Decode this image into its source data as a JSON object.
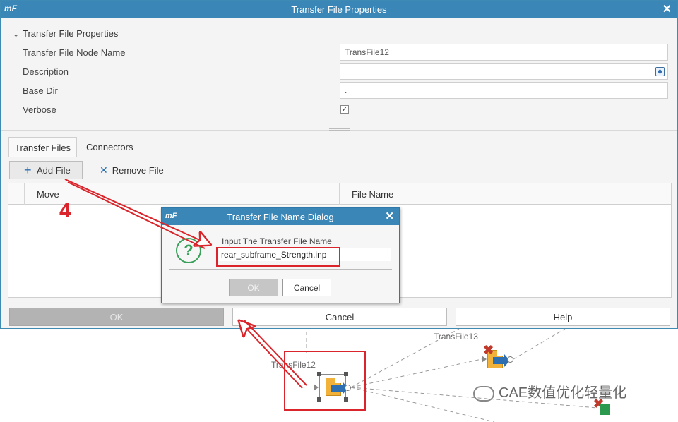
{
  "main_dialog": {
    "logo": "mF",
    "title": "Transfer File Properties",
    "close": "✕",
    "section": {
      "toggle": "⌄",
      "title": "Transfer File Properties",
      "fields": {
        "node_name_label": "Transfer File Node Name",
        "node_name_value": "TransFile12",
        "description_label": "Description",
        "description_value": "",
        "base_dir_label": "Base Dir",
        "base_dir_value": ".",
        "verbose_label": "Verbose",
        "verbose_checked": "✓"
      }
    },
    "tabs": [
      {
        "label": "Transfer Files",
        "active": true
      },
      {
        "label": "Connectors",
        "active": false
      }
    ],
    "toolbar": {
      "add_icon": "+",
      "add_label": "Add File",
      "remove_icon": "✕",
      "remove_label": "Remove File"
    },
    "table": {
      "columns": [
        "Move",
        "File Name"
      ]
    },
    "buttons": {
      "ok": "OK",
      "cancel": "Cancel",
      "help": "Help"
    }
  },
  "name_dialog": {
    "logo": "mF",
    "title": "Transfer File Name Dialog",
    "close": "✕",
    "icon": "?",
    "prompt": "Input The Transfer File Name",
    "input_value": "rear_subframe_Strength.inp",
    "ok": "OK",
    "cancel": "Cancel"
  },
  "annotation": {
    "step": "4"
  },
  "workflow": {
    "node_selected_label": "TransFile12",
    "node_other_label": "TransFile13"
  },
  "watermark": {
    "text": "CAE数值优化轻量化"
  },
  "colors": {
    "titlebar": "#3a86b6",
    "annotation_red": "#d9252b",
    "accent_blue": "#2b6fb1"
  }
}
